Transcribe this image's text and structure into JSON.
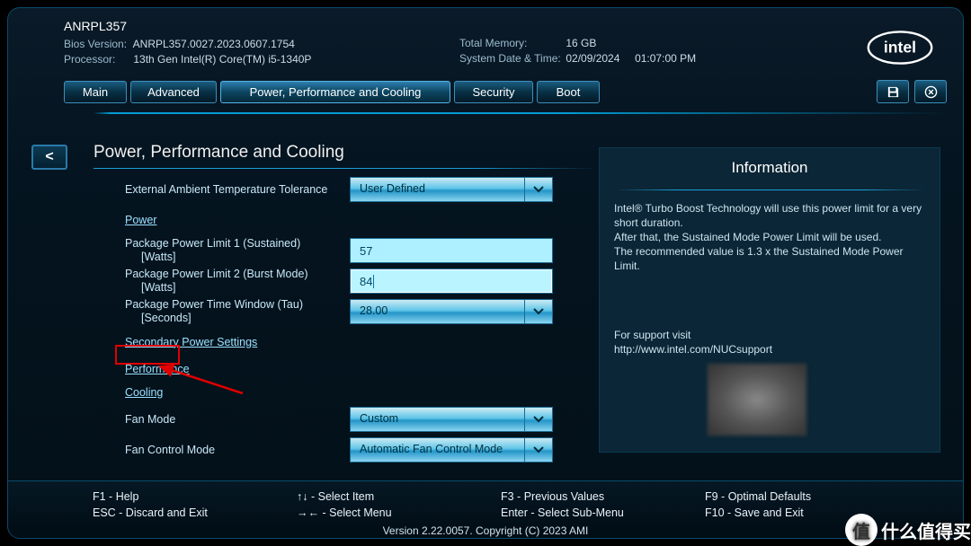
{
  "header": {
    "product": "ANRPL357",
    "bios_version_label": "Bios Version:",
    "bios_version": "ANRPL357.0027.2023.0607.1754",
    "processor_label": "Processor:",
    "processor": "13th Gen Intel(R) Core(TM) i5-1340P",
    "total_memory_label": "Total Memory:",
    "total_memory": "16 GB",
    "datetime_label": "System Date & Time:",
    "date": "02/09/2024",
    "time": "01:07:00 PM"
  },
  "logo_text": "intel",
  "tabs": {
    "main": "Main",
    "advanced": "Advanced",
    "ppc": "Power, Performance and Cooling",
    "security": "Security",
    "boot": "Boot"
  },
  "back_glyph": "<",
  "page": {
    "title": "Power, Performance and Cooling",
    "ext_temp_label": "External Ambient Temperature Tolerance",
    "ext_temp_value": "User Defined",
    "power_link": "Power",
    "ppl1_label": "Package Power Limit 1 (Sustained)",
    "ppl1_unit": "[Watts]",
    "ppl1_value": "57",
    "ppl2_label": "Package Power Limit 2 (Burst Mode)",
    "ppl2_unit": "[Watts]",
    "ppl2_value": "84",
    "tau_label": "Package Power Time Window (Tau)",
    "tau_unit": "[Seconds]",
    "tau_value": "28.00",
    "secondary_link": "Secondary Power Settings",
    "performance_link": "Performance",
    "cooling_link": "Cooling",
    "fan_mode_label": "Fan Mode",
    "fan_mode_value": "Custom",
    "fan_control_label": "Fan Control Mode",
    "fan_control_value": "Automatic Fan Control Mode"
  },
  "info": {
    "title": "Information",
    "body_l1": "Intel® Turbo Boost Technology will use this power limit for a very short duration.",
    "body_l2": "After that, the Sustained Mode Power Limit will be used.",
    "body_l3": "The recommended value is 1.3 x the Sustained Mode Power Limit.",
    "support_l1": "For support visit",
    "support_l2": "http://www.intel.com/NUCsupport"
  },
  "footer": {
    "f1": "F1 - Help",
    "esc": "ESC - Discard and Exit",
    "updown": "↑↓ - Select Item",
    "leftright": "→← - Select Menu",
    "f3": "F3 - Previous Values",
    "enter": "Enter - Select Sub-Menu",
    "f9": "F9 - Optimal Defaults",
    "f10": "F10 - Save and Exit",
    "version": "Version 2.22.0057. Copyright (C) 2023 AMI"
  },
  "watermark": "什么值得买"
}
